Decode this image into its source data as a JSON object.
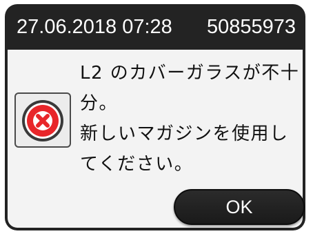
{
  "header": {
    "datetime": "27.06.2018 07:28",
    "serial": "50855973"
  },
  "message": {
    "lines": [
      "L2 のカバーガラスが不十",
      "分。",
      "新しいマガジンを使用し",
      "てください。"
    ]
  },
  "icon": {
    "name": "error-icon",
    "color": "#e8262a"
  },
  "buttons": {
    "ok_label": "OK"
  },
  "colors": {
    "titlebar": "#232323",
    "content": "#f3f3f3",
    "error_red": "#e8262a"
  }
}
